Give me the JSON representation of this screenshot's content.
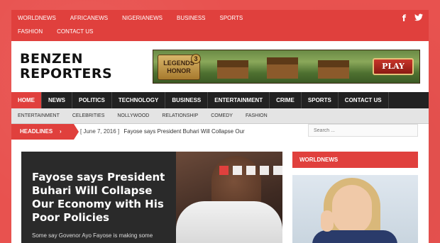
{
  "topnav": [
    "WORLDNEWS",
    "AFRICANEWS",
    "NIGERIANEWS",
    "BUSINESS",
    "SPORTS",
    "FASHION",
    "CONTACT US"
  ],
  "social": {
    "facebook": "f",
    "twitter": "t"
  },
  "logo": {
    "line1": "BENZEN",
    "line2": "REPORTERS"
  },
  "banner": {
    "game_line1": "LEGENDS",
    "game_line2": "HONOR",
    "game_number": "3",
    "play_label": "PLAY"
  },
  "mainnav": [
    "HOME",
    "NEWS",
    "POLITICS",
    "TECHNOLOGY",
    "BUSINESS",
    "ENTERTAINMENT",
    "CRIME",
    "SPORTS",
    "CONTACT US"
  ],
  "subnav": [
    "ENTERTAINMENT",
    "CELEBRITIES",
    "NOLLYWOOD",
    "RELATIONSHIP",
    "COMEDY",
    "FASHION"
  ],
  "headlines": {
    "label": "HEADLINES",
    "chevron": "›",
    "date": "[ June 7, 2016 ]",
    "text": "Fayose says President Buhari Will Collapse Our"
  },
  "search": {
    "placeholder": "Search ..."
  },
  "feature": {
    "title": "Fayose says President Buhari Will Collapse Our Economy with His Poor Policies",
    "excerpt": "Some say Govenor Ayo Fayose is making some points but the fact that he"
  },
  "sidebar": {
    "worldnews_label": "WORLDNEWS"
  },
  "colors": {
    "accent": "#e0403d",
    "nav": "#222222",
    "subnav": "#e4e4e4"
  }
}
